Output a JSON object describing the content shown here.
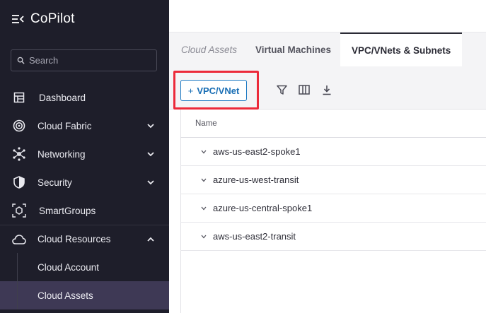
{
  "app": {
    "title": "CoPilot"
  },
  "search": {
    "placeholder": "Search"
  },
  "sidebar": {
    "items": [
      {
        "label": "Dashboard",
        "icon": "dashboard-icon",
        "expandable": false
      },
      {
        "label": "Cloud Fabric",
        "icon": "cloud-fabric-icon",
        "expandable": true,
        "expanded": false
      },
      {
        "label": "Networking",
        "icon": "networking-icon",
        "expandable": true,
        "expanded": false
      },
      {
        "label": "Security",
        "icon": "shield-icon",
        "expandable": true,
        "expanded": false
      },
      {
        "label": "SmartGroups",
        "icon": "smartgroups-icon",
        "expandable": false
      },
      {
        "label": "Cloud Resources",
        "icon": "cloud-icon",
        "expandable": true,
        "expanded": true
      }
    ],
    "sub_items": [
      {
        "label": "Cloud Account",
        "active": false
      },
      {
        "label": "Cloud Assets",
        "active": true
      }
    ]
  },
  "tabs": [
    {
      "label": "Cloud Assets",
      "state": "muted"
    },
    {
      "label": "Virtual Machines",
      "state": "normal"
    },
    {
      "label": "VPC/VNets & Subnets",
      "state": "active"
    }
  ],
  "toolbar": {
    "add_button_label": "VPC/VNet",
    "add_button_prefix": "+",
    "icons": [
      "filter-icon",
      "columns-icon",
      "download-icon"
    ]
  },
  "table": {
    "columns": [
      "Name"
    ],
    "rows": [
      "aws-us-east2-spoke1",
      "azure-us-west-transit",
      "azure-us-central-spoke1",
      "aws-us-east2-transit"
    ]
  },
  "colors": {
    "sidebar_bg": "#1e1e2a",
    "active_sub_bg": "#3e3955",
    "accent_blue": "#1a78c2",
    "highlight_red": "#ec2a3a"
  }
}
